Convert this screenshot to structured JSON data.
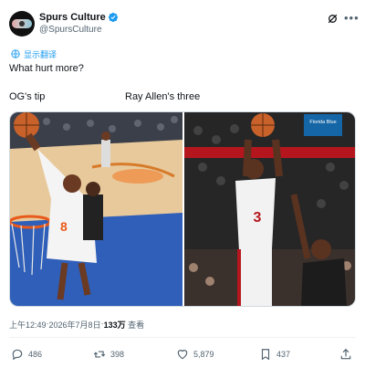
{
  "tweet": {
    "author_name": "Spurs Culture",
    "handle": "@SpursCulture",
    "translate_label": "显示翻译",
    "text": "What hurt more?",
    "caption_left": "OG's tip",
    "caption_right": "Ray Allen's three",
    "meta": {
      "time": "上午12:49",
      "separator": " · ",
      "date": "2026年7月8日",
      "views_count": "133万",
      "views_label": "查看"
    },
    "actions": {
      "replies": "486",
      "reposts": "398",
      "likes": "5,879",
      "bookmarks": "437"
    }
  },
  "media": {
    "right_banner_text": "Florida Blue"
  },
  "colors": {
    "accent": "#1d9bf0",
    "text": "#0f1419",
    "muted": "#536471"
  }
}
